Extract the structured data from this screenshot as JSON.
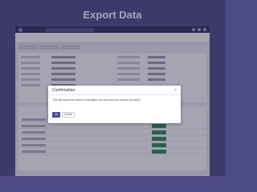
{
  "header": {
    "title": "Export Data"
  },
  "dialog": {
    "title": "Confirmation",
    "close_glyph": "×",
    "message": "This will export the data to Snowflake. Are you sure you want to proceed?",
    "ok_label": "Ok",
    "cancel_label": "Cancel"
  },
  "colors": {
    "background": "#4c4987",
    "app_header": "#2d2a5e",
    "primary_button": "#4b4898",
    "status_pill": "#2e8a55"
  }
}
